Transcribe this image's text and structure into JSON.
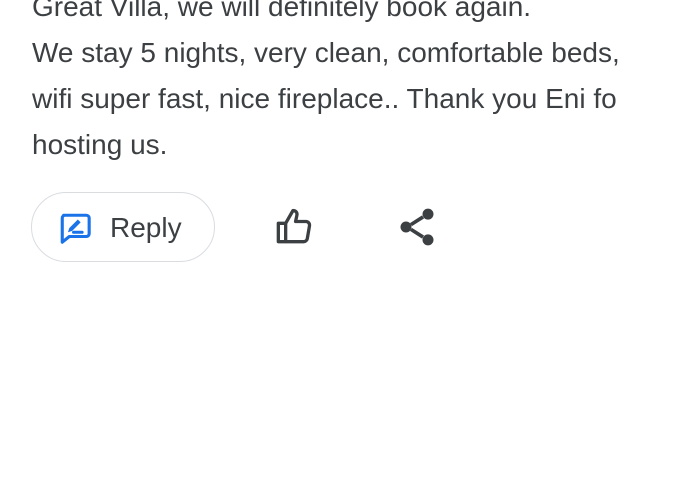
{
  "review": {
    "lines": [
      "Great Villa, we will definitely book again.",
      "We stay 5 nights, very clean, comfortable beds,",
      "wifi super fast, nice fireplace.. Thank you Eni fo",
      "hosting us."
    ]
  },
  "actions": {
    "reply": {
      "label": "Reply",
      "icon": "reply-edit-icon"
    },
    "like": {
      "icon": "thumbs-up-icon"
    },
    "share": {
      "icon": "share-icon"
    }
  },
  "colors": {
    "text": "#3c4043",
    "accent": "#1a73e8",
    "border": "#dadce0",
    "background": "#ffffff"
  }
}
